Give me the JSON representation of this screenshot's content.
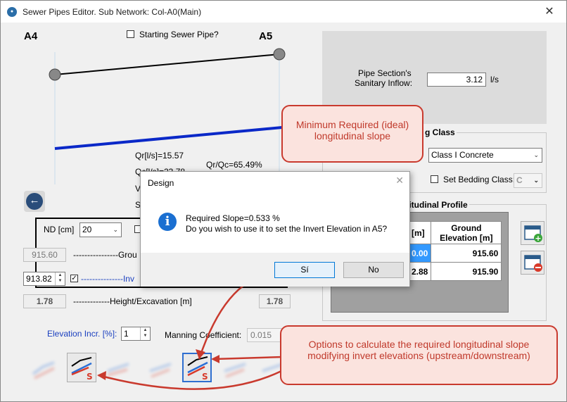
{
  "window": {
    "title": "Sewer Pipes Editor. Sub Network: Col-A0(Main)",
    "close_glyph": "✕"
  },
  "profile": {
    "node_upstream": "A4",
    "node_downstream": "A5",
    "starting_pipe_label": "Starting Sewer Pipe?",
    "qr": "Qr[l/s]=15.57",
    "qc": "Qc[l/s]=23.78",
    "qr_qc": "Qr/Qc=65.49%",
    "v_partial": "V",
    "s_partial": "S"
  },
  "inflow": {
    "label_line1": "Pipe Section's",
    "label_line2": "Sanitary Inflow:",
    "value": "3.12",
    "unit": "l/s"
  },
  "bedding": {
    "group_title_partial": "g Class",
    "class_value": "Class I Concrete",
    "set_bedding_label": "Set Bedding Class:",
    "bedding_value": "C"
  },
  "pipe": {
    "nd_label": "ND [cm]",
    "nd_value": "20",
    "ground_up": "915.60",
    "ground_label": "----------------Grou",
    "invert_up": "913.82",
    "invert_label": "---------------Inv",
    "height_up": "1.78",
    "height_label": "-------------Height/Excavation [m]",
    "height_down": "1.78"
  },
  "long_profile": {
    "group_title_partial": "gitudinal Profile",
    "col1_header_partial": "[m]",
    "col2_header": "Ground Elevation [m]",
    "rows": [
      {
        "c1": "0.00",
        "c2": "915.60"
      },
      {
        "c1": "2.88",
        "c2": "915.90"
      }
    ]
  },
  "bottom": {
    "elevation_incr_label": "Elevation Incr. [%]:",
    "elevation_incr_value": "1",
    "manning_label": "Manning Coefficient:",
    "manning_value": "0.015",
    "tool_s_glyph": "S"
  },
  "dialog": {
    "title": "Design",
    "close_glyph": "✕",
    "line1": "Required Slope=0.533 %",
    "line2": "Do you wish to use it to set the Invert Elevation in A5?",
    "yes_label": "Sí",
    "no_label": "No"
  },
  "callouts": {
    "top": "Minimum Required (ideal) longitudinal slope",
    "bottom": "Options to calculate the required longitudinal slope modifying invert elevations (upstream/downstream)"
  },
  "colors": {
    "pipe_line": "#0a28c8",
    "callout_border": "#c93a2e",
    "callout_text": "#c0392b",
    "info_icon": "#1a6fd1"
  }
}
